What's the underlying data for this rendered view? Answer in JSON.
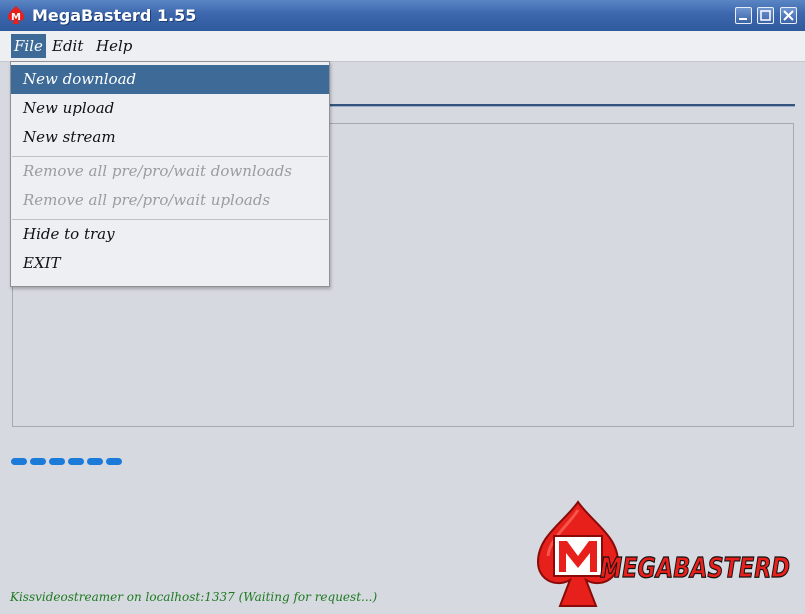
{
  "window": {
    "title": "MegaBasterd 1.55",
    "icon": "megabasterd-app-icon",
    "controls": [
      "minimize-icon",
      "maximize-icon",
      "close-icon"
    ]
  },
  "menubar": {
    "items": [
      {
        "label": "File",
        "active": true
      },
      {
        "label": "Edit",
        "active": false
      },
      {
        "label": "Help",
        "active": false
      }
    ]
  },
  "file_menu": {
    "items": [
      {
        "label": "New download",
        "state": "selected"
      },
      {
        "label": "New upload",
        "state": "enabled"
      },
      {
        "label": "New stream",
        "state": "enabled"
      },
      {
        "label": "Remove all pre/pro/wait downloads",
        "state": "disabled"
      },
      {
        "label": "Remove all pre/pro/wait uploads",
        "state": "disabled"
      },
      {
        "label": "Hide to tray",
        "state": "enabled"
      },
      {
        "label": "EXIT",
        "state": "enabled"
      }
    ]
  },
  "status_bar": {
    "text": "Kissvideostreamer on localhost:1337 (Waiting for request...)"
  },
  "logo": {
    "text": "MEGABASTERD",
    "brand_color": "#e8201c"
  },
  "colors": {
    "titlebar": "#3c67ad",
    "selection": "#3d6a96",
    "progress": "#1c7bd8",
    "status_text": "#1d7a22"
  }
}
